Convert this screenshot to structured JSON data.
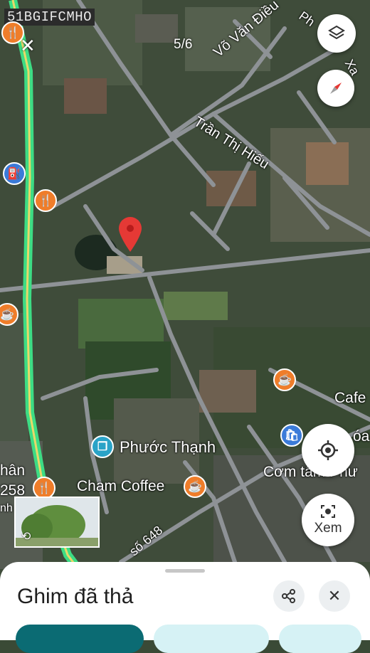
{
  "watermark": "51BGIFCMHO",
  "counter": "5/6",
  "streets": {
    "vo_van_dieu": "Võ Văn Điều",
    "tran_thi_hieu": "Trần Thị Hiếu",
    "road_648": "số 648",
    "top_right": "Ph",
    "top_right_2": "Xa"
  },
  "places": {
    "phuoc_thanh": "Phước Thạnh",
    "cham_coffee": "Cham Coffee",
    "com_tam": "Cơm tấm Phư",
    "cafe": "Cafe",
    "hoa": "óa",
    "left_1": "hân",
    "left_2": "258",
    "left_3": "nh"
  },
  "buttons": {
    "xem_label": "Xem"
  },
  "sheet": {
    "title": "Ghim đã thả"
  },
  "colors": {
    "pin": "#e53935",
    "highway": "#3ddc84",
    "poi_orange": "#ef7d2a",
    "poi_blue": "#3b7bd9"
  }
}
